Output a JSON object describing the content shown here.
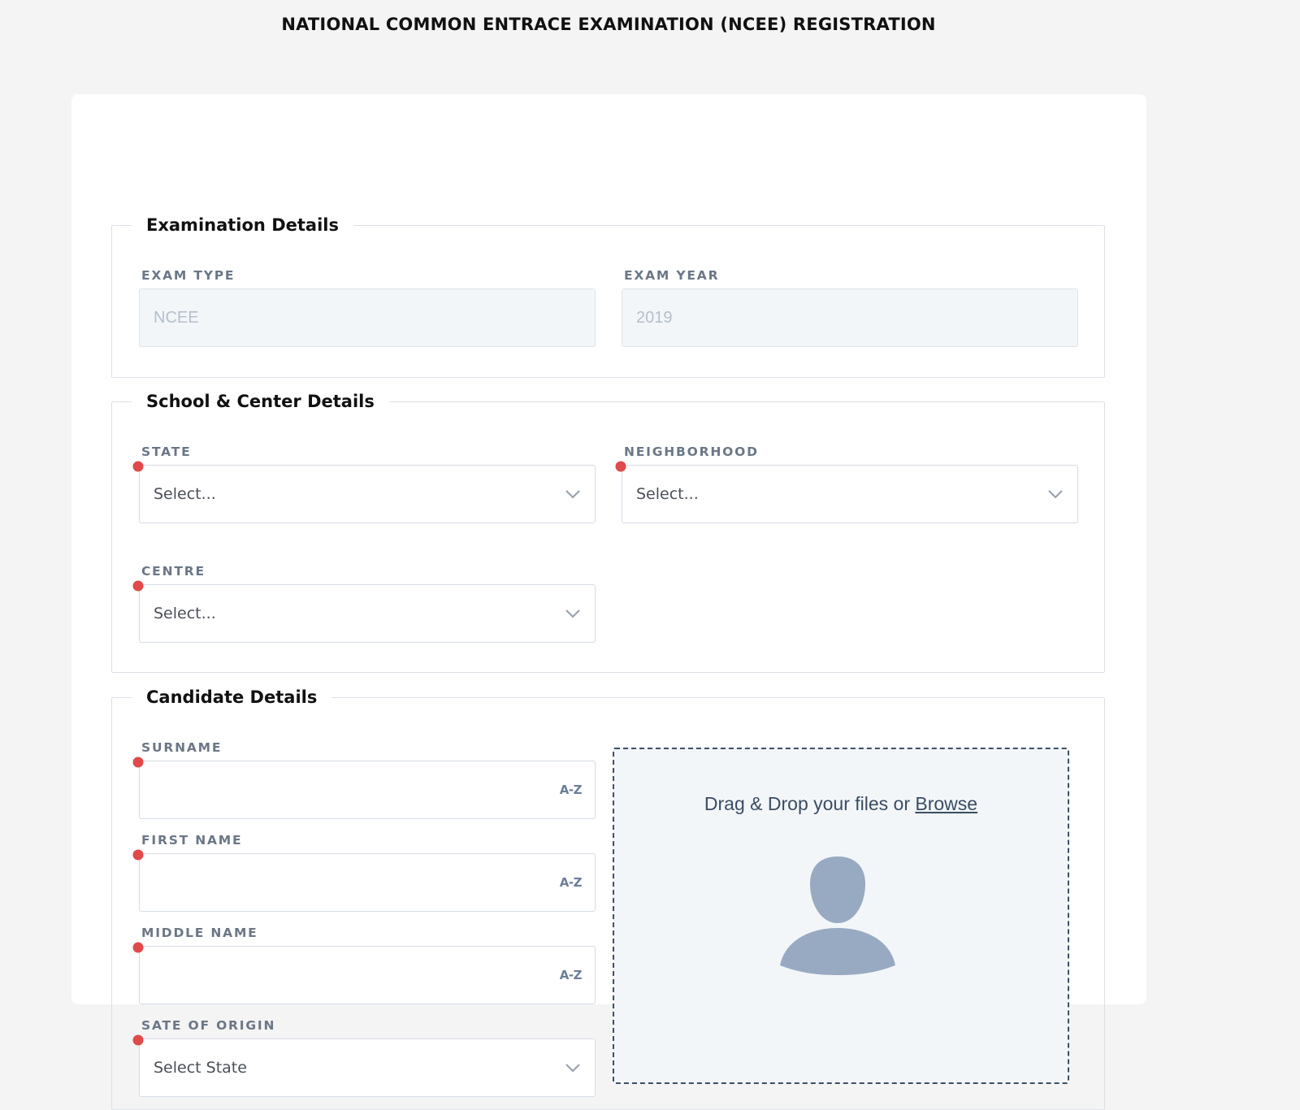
{
  "page_title": "NATIONAL COMMON ENTRACE EXAMINATION (NCEE) REGISTRATION",
  "sections": {
    "exam": {
      "legend": "Examination Details",
      "exam_type": {
        "label": "EXAM TYPE",
        "value": "NCEE"
      },
      "exam_year": {
        "label": "EXAM YEAR",
        "value": "2019"
      }
    },
    "school": {
      "legend": "School & Center Details",
      "state": {
        "label": "STATE",
        "value": "Select..."
      },
      "neighborhood": {
        "label": "NEIGHBORHOOD",
        "value": "Select..."
      },
      "centre": {
        "label": "CENTRE",
        "value": "Select..."
      }
    },
    "candidate": {
      "legend": "Candidate Details",
      "surname": {
        "label": "SURNAME",
        "value": "",
        "badge": "A-Z"
      },
      "first_name": {
        "label": "FIRST NAME",
        "value": "",
        "badge": "A-Z"
      },
      "middle_name": {
        "label": "MIDDLE NAME",
        "value": "",
        "badge": "A-Z"
      },
      "state_of_origin": {
        "label": "SATE OF ORIGIN",
        "value": "Select State"
      },
      "upload": {
        "text": "Drag & Drop your files or ",
        "link": "Browse"
      }
    }
  },
  "colors": {
    "required_marker": "#e04a4a",
    "label": "#6b7787",
    "avatar": "#98aac1"
  },
  "icons": [
    "chevron-down-icon",
    "required-marker-icon",
    "avatar-placeholder-icon"
  ]
}
